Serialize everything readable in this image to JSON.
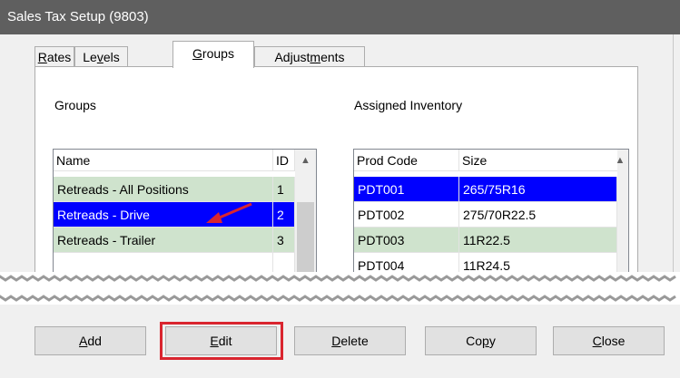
{
  "window": {
    "title": "Sales Tax Setup (9803)"
  },
  "tabs": [
    {
      "pre": "",
      "key": "R",
      "post": "ates",
      "active": false
    },
    {
      "pre": "Le",
      "key": "v",
      "post": "els",
      "active": false
    },
    {
      "pre": "",
      "key": "G",
      "post": "roups",
      "active": true
    },
    {
      "pre": "Adjust",
      "key": "m",
      "post": "ents",
      "active": false
    }
  ],
  "groups": {
    "label": "Groups",
    "columns": [
      "Name",
      "ID"
    ],
    "rows": [
      {
        "name": "Retreads - All Positions",
        "id": "1",
        "state": "green"
      },
      {
        "name": "Retreads - Drive",
        "id": "2",
        "state": "selected"
      },
      {
        "name": "Retreads - Trailer",
        "id": "3",
        "state": "green"
      },
      {
        "name": "",
        "id": "",
        "state": "plain"
      }
    ]
  },
  "inventory": {
    "label": "Assigned Inventory",
    "columns": [
      "Prod Code",
      "Size"
    ],
    "rows": [
      {
        "code": "PDT001",
        "size": "265/75R16",
        "state": "selected"
      },
      {
        "code": "PDT002",
        "size": "275/70R22.5",
        "state": "plain"
      },
      {
        "code": "PDT003",
        "size": "11R22.5",
        "state": "green"
      },
      {
        "code": "PDT004",
        "size": "11R24.5",
        "state": "plain"
      }
    ]
  },
  "buttons": {
    "add": {
      "pre": "",
      "key": "A",
      "post": "dd"
    },
    "edit": {
      "pre": "",
      "key": "E",
      "post": "dit"
    },
    "delete": {
      "pre": "",
      "key": "D",
      "post": "elete"
    },
    "copy": {
      "pre": "Co",
      "key": "p",
      "post": "y"
    },
    "close": {
      "pre": "",
      "key": "C",
      "post": "lose"
    }
  },
  "colors": {
    "title_bar": "#5f5f5f",
    "selection": "#0000ff",
    "row_green": "#cfe3cd",
    "callout_red": "#d9252f"
  },
  "icons": {
    "scroll_up": "chevron-up-icon",
    "callout": "red-arrow-icon"
  }
}
